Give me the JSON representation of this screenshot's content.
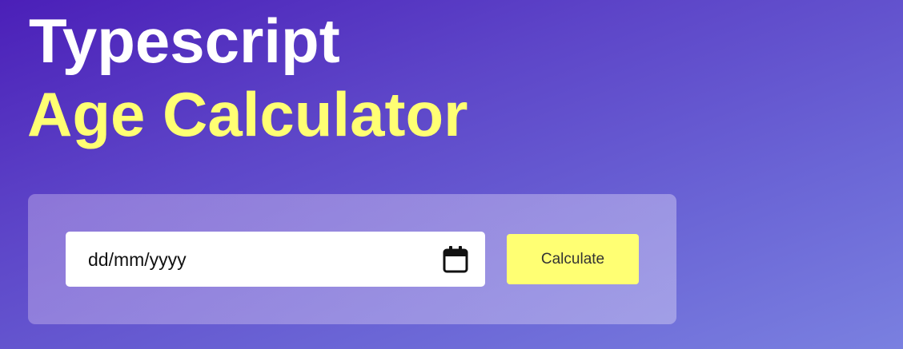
{
  "header": {
    "title_line_1": "Typescript",
    "title_line_2": "Age Calculator"
  },
  "form": {
    "date_value": "dd/mm/yyyy",
    "calendar_icon": "calendar-icon",
    "calculate_label": "Calculate"
  },
  "colors": {
    "accent_yellow": "#ffff73",
    "title_white": "#ffffff",
    "background_start": "#4b1fb8",
    "background_end": "#7a80e0"
  }
}
